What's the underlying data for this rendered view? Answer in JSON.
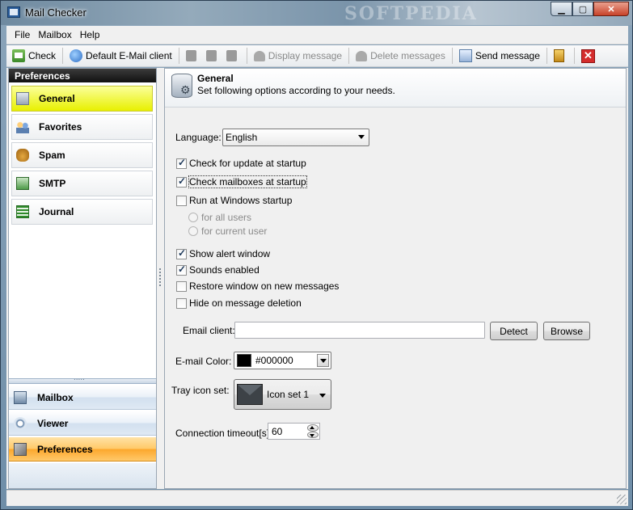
{
  "window": {
    "title": "Mail Checker",
    "watermark": "SOFTPEDIA",
    "controls": {
      "minimize": "▁",
      "maximize": "▢",
      "close": "✕"
    }
  },
  "menu": [
    "File",
    "Mailbox",
    "Help"
  ],
  "toolbar": {
    "check": "Check",
    "default_client": "Default E-Mail client",
    "display_message": "Display message",
    "delete_messages": "Delete messages",
    "send_message": "Send message",
    "close_glyph": "✕"
  },
  "sidebar": {
    "header": "Preferences",
    "items": [
      "General",
      "Favorites",
      "Spam",
      "SMTP",
      "Journal"
    ],
    "bottom": [
      "Mailbox",
      "Viewer",
      "Preferences"
    ]
  },
  "panel": {
    "title": "General",
    "subtitle": "Set following options according to your needs."
  },
  "form": {
    "language_label": "Language:",
    "language_value": "English",
    "check_update": "Check for update at startup",
    "check_mailboxes": "Check mailboxes at startup",
    "run_windows": "Run at Windows startup",
    "all_users": "for all users",
    "current_user": "for current user",
    "show_alert": "Show alert window",
    "sounds": "Sounds enabled",
    "restore_window": "Restore window  on new messages",
    "hide_deletion": "Hide on message deletion",
    "email_client_label": "Email client:",
    "email_client_value": "",
    "detect": "Detect",
    "browse": "Browse",
    "color_label": "E-mail Color:",
    "color_value": "#000000",
    "tray_label": "Tray icon set:",
    "tray_value": "Icon set 1",
    "timeout_label": "Connection timeout[s]:",
    "timeout_value": "60"
  },
  "colors": {
    "active_nav": "#e8f000",
    "active_bottom_nav": "#fca72b",
    "close_red": "#d42c2c",
    "email_color": "#000000"
  }
}
